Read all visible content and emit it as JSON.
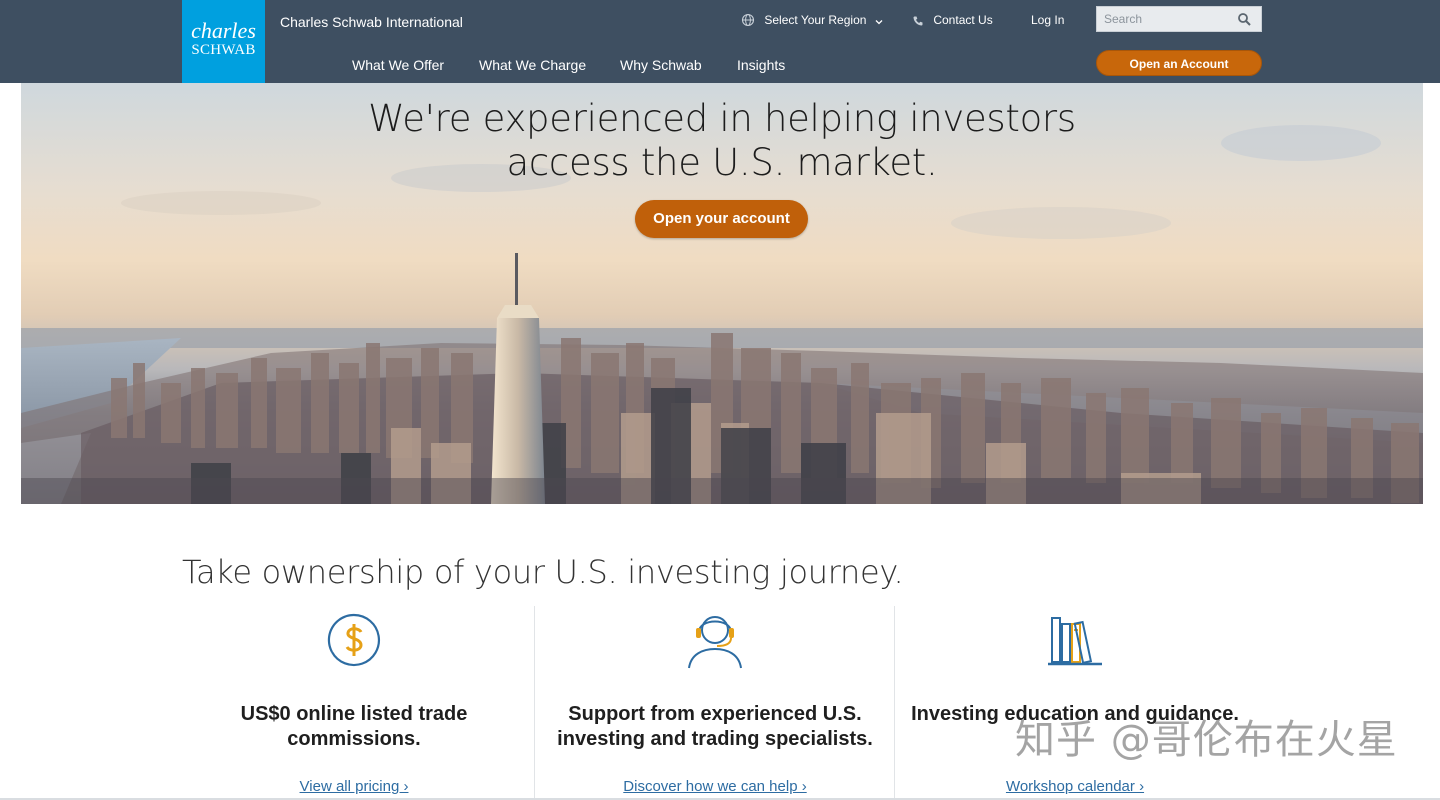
{
  "header": {
    "logo_line1": "charles",
    "logo_line2": "SCHWAB",
    "site_name": "Charles Schwab International",
    "region_label": "Select Your Region",
    "contact_label": "Contact Us",
    "login_label": "Log In",
    "search_placeholder": "Search",
    "open_account_label": "Open an Account",
    "nav": [
      "What We Offer",
      "What We Charge",
      "Why Schwab",
      "Insights"
    ]
  },
  "hero": {
    "title_line1": "We're experienced in helping investors",
    "title_line2": "access the U.S. market.",
    "cta_label": "Open your account"
  },
  "main": {
    "lead": "Take ownership of your U.S. investing journey.",
    "features": [
      {
        "icon": "dollar-icon",
        "heading": "US$0 online listed trade commissions.",
        "link": "View all pricing ›"
      },
      {
        "icon": "headset-icon",
        "heading": "Support from experienced U.S. investing and trading specialists.",
        "link": "Discover how we can help ›"
      },
      {
        "icon": "books-icon",
        "heading": "Investing education and guidance.",
        "link": "Workshop calendar ›"
      }
    ]
  },
  "watermark": "知乎 @哥伦布在火星",
  "colors": {
    "header_bg": "#3e4f61",
    "logo_bg": "#00a0df",
    "cta_orange": "#c0600a",
    "link_blue": "#2d6ca2"
  }
}
